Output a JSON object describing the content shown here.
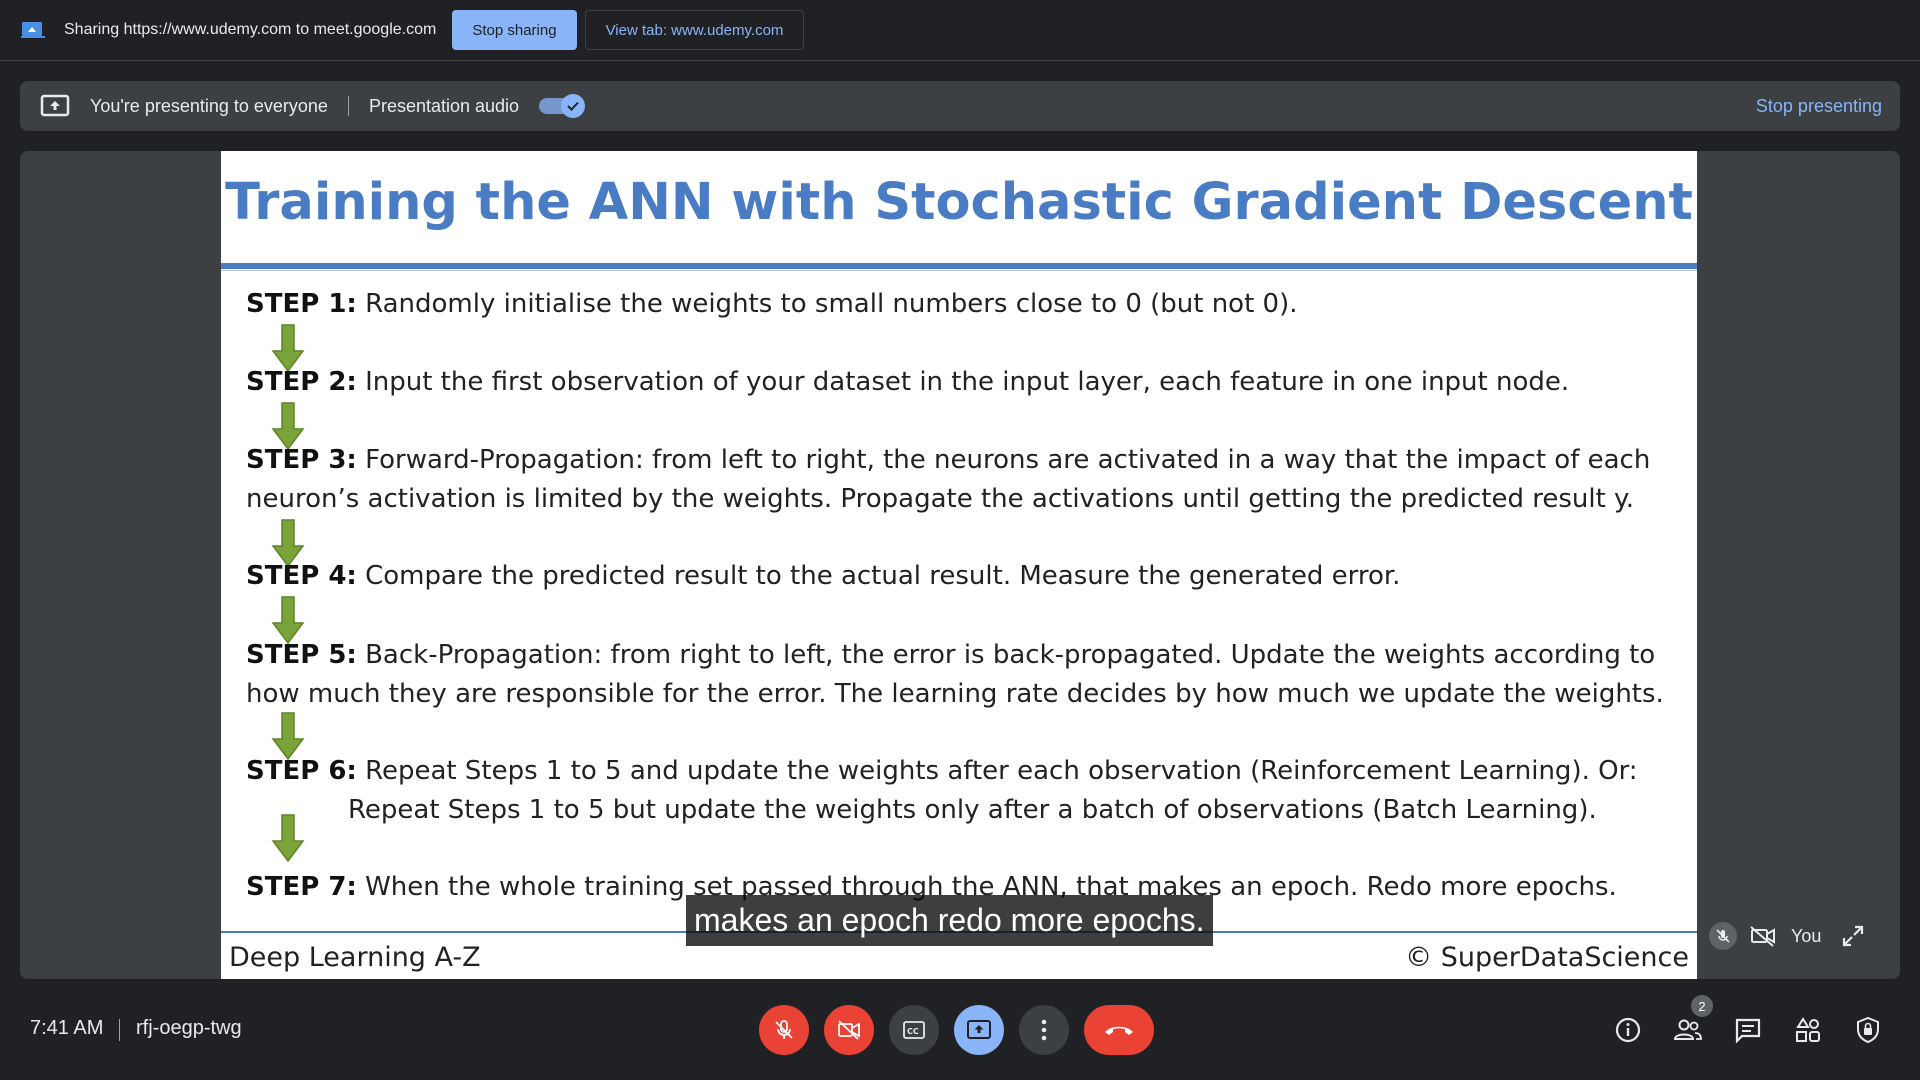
{
  "share_bar": {
    "sharing_text": "Sharing https://www.udemy.com to meet.google.com",
    "stop_sharing_label": "Stop sharing",
    "view_tab_label": "View tab: www.udemy.com"
  },
  "presenting_bar": {
    "status_text": "You're presenting to everyone",
    "audio_label": "Presentation audio",
    "audio_enabled": true,
    "stop_presenting_label": "Stop presenting"
  },
  "slide": {
    "title": "Training the ANN with Stochastic Gradient Descent",
    "steps": [
      {
        "label": "STEP 1:",
        "text": "Randomly initialise the weights to small numbers close to 0 (but not 0)."
      },
      {
        "label": "STEP 2:",
        "text": "Input the first observation of your dataset in the input layer, each feature in one input node."
      },
      {
        "label": "STEP 3:",
        "text": "Forward-Propagation: from left to right, the neurons are activated in a way that the impact of each",
        "text2": "neuron’s activation is limited by the weights. Propagate the activations until getting the predicted result y."
      },
      {
        "label": "STEP 4:",
        "text": "Compare the predicted result to the actual result. Measure the generated error."
      },
      {
        "label": "STEP 5:",
        "text": "Back-Propagation: from right to left, the error is back-propagated. Update the weights according to",
        "text2": "how much they are responsible for the error. The learning rate decides by how much we update the weights."
      },
      {
        "label": "STEP 6:",
        "text": "Repeat Steps 1 to 5 and update the weights after each observation (Reinforcement Learning). Or:",
        "text2": "Repeat Steps 1 to 5 but update the weights only after a batch of observations (Batch Learning)."
      },
      {
        "label": "STEP 7:",
        "text": "When the whole training set passed through the ANN, that makes an epoch. Redo more epochs."
      }
    ],
    "footer_left": "Deep Learning A-Z",
    "footer_right": "© SuperDataScience",
    "caption": "makes an epoch redo more epochs."
  },
  "self_tile": {
    "name": "You"
  },
  "bottom_bar": {
    "time": "7:41 AM",
    "meeting_code": "rfj-oegp-twg",
    "participants_count": "2"
  },
  "colors": {
    "accent": "#8ab4f8",
    "danger": "#ea4335",
    "slide_title": "#4a7cc4",
    "arrow": "#7aa33a"
  }
}
